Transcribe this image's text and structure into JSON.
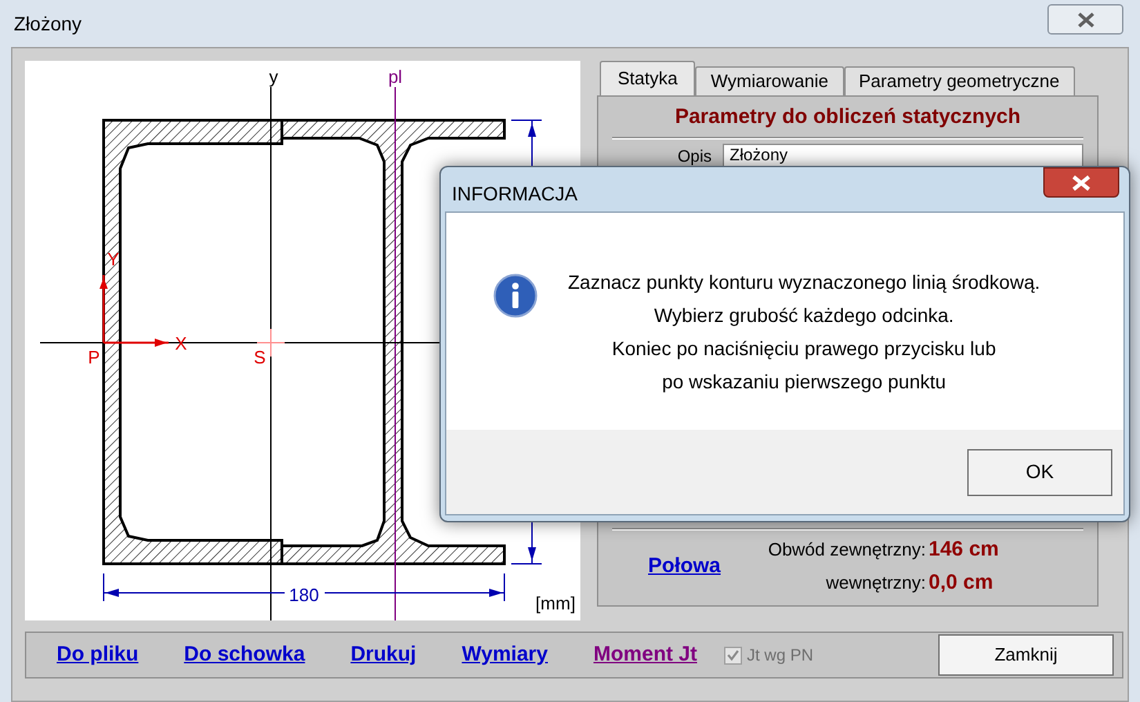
{
  "window": {
    "title": "Złożony"
  },
  "drawing": {
    "labels": [
      {
        "kind": "axis",
        "text": "y"
      },
      {
        "kind": "plastic",
        "text": "pl"
      },
      {
        "kind": "local_y",
        "text": "Y"
      },
      {
        "kind": "local_x",
        "text": "X"
      },
      {
        "kind": "origin",
        "text": "P"
      },
      {
        "kind": "centroid",
        "text": "S"
      },
      {
        "kind": "dimension",
        "text": "180"
      },
      {
        "kind": "unit",
        "text": "[mm]"
      }
    ]
  },
  "tabs": [
    {
      "label": "Statyka",
      "selected": true
    },
    {
      "label": "Wymiarowanie",
      "selected": false
    },
    {
      "label": "Parametry geometryczne",
      "selected": false
    }
  ],
  "panel": {
    "heading": "Parametry do obliczeń statycznych",
    "field_label": "Opis",
    "field_value": "Złożony",
    "link": "Połowa",
    "results": [
      {
        "label": "Obwód zewnętrzny:",
        "value": "146 cm"
      },
      {
        "label": "wewnętrzny:",
        "value": "0,0 cm"
      }
    ]
  },
  "bottom_bar": {
    "links": [
      {
        "label": "Do pliku",
        "visited": false
      },
      {
        "label": "Do schowka",
        "visited": false
      },
      {
        "label": "Drukuj",
        "visited": false
      },
      {
        "label": "Wymiary",
        "visited": false
      },
      {
        "label": "Moment Jt",
        "visited": true
      }
    ],
    "checkbox": {
      "label": "Jt wg PN",
      "checked": true,
      "disabled": true
    },
    "button": "Zamknij"
  },
  "dialog": {
    "title": "INFORMACJA",
    "lines": [
      "Zaznacz punkty konturu wyznaczonego linią środkową.",
      "Wybierz grubość każdego odcinka.",
      "Koniec po naciśnięciu prawego przycisku lub",
      "po wskazaniu pierwszego punktu"
    ],
    "button": "OK"
  }
}
